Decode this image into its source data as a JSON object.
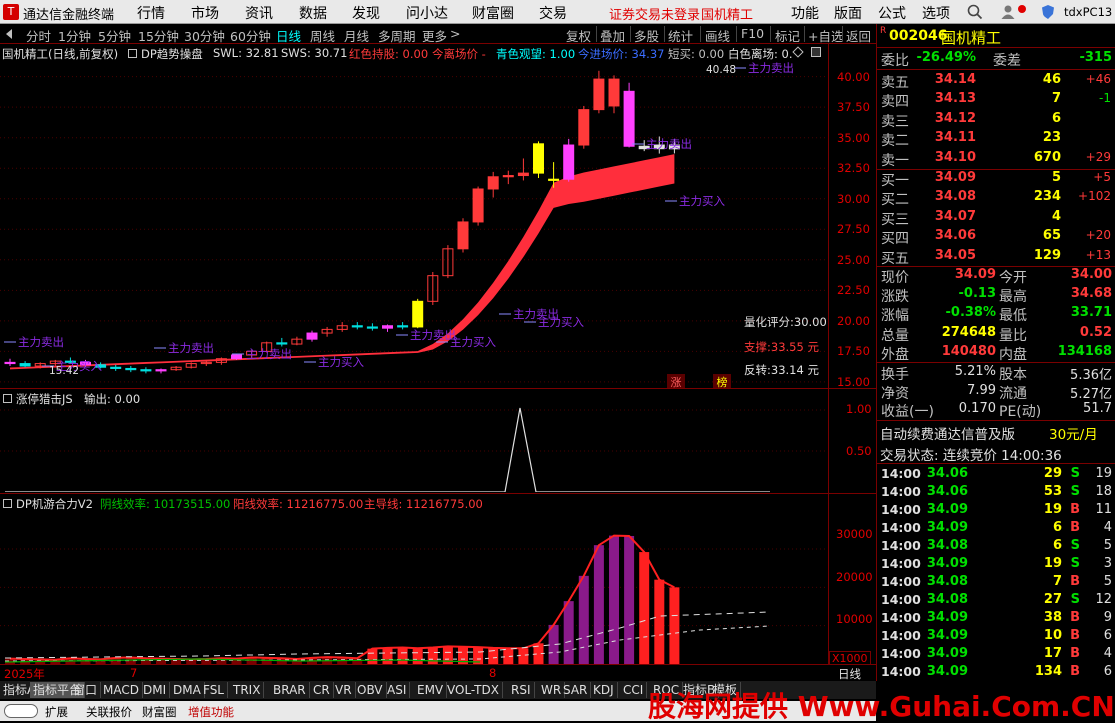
{
  "app": {
    "title": "通达信金融终端",
    "brand_color": "#d40000"
  },
  "menu": {
    "items": [
      "行情",
      "市场",
      "资讯",
      "数据",
      "发现",
      "问小达",
      "财富圈",
      "交易"
    ],
    "notice": "证券交易未登录",
    "stock": "国机精工",
    "right": [
      "功能",
      "版面",
      "公式",
      "选项"
    ],
    "user": "tdxPC13"
  },
  "period_tabs": [
    "分时",
    "1分钟",
    "5分钟",
    "15分钟",
    "30分钟",
    "60分钟",
    "日线",
    "周线",
    "月线",
    "多周期",
    "更多"
  ],
  "active_period": "日线",
  "toolbar_right": [
    "复权",
    "叠加",
    "多股",
    "统计",
    "画线",
    "F10",
    "标记",
    "+自选",
    "返回"
  ],
  "main_chart": {
    "title": "国机精工(日线,前复权)",
    "indicator": "DP趋势操盘",
    "swl": "SWL: 32.81",
    "sws": "SWS: 30.71",
    "legend": [
      {
        "text": "红色持股: 0.00",
        "color": "#ff3a3a"
      },
      {
        "text": "今离场价 -",
        "color": "#ff3a3a"
      },
      {
        "text": "青色观望: 1.00",
        "color": "#00ffff"
      },
      {
        "text": "今进场价: 34.37",
        "color": "#3a6cff"
      },
      {
        "text": "短买: 0.00",
        "color": "#c0c0c0"
      },
      {
        "text": "白色离场: 0.",
        "color": "#e0e0e0"
      }
    ],
    "y_ticks": [
      "40.00",
      "37.50",
      "35.00",
      "32.50",
      "30.00",
      "27.50",
      "25.00",
      "22.50",
      "20.00",
      "17.50",
      "15.00"
    ],
    "max_label": "40.48",
    "min_label": "15.42",
    "signals": {
      "sell": "主力卖出",
      "buy": "主力买入"
    },
    "score": "量化评分:30.00",
    "support": "支撑:33.55 元",
    "reversal": "反转:33.14 元",
    "markers": [
      "涨",
      "榜"
    ]
  },
  "panel2": {
    "title": "涨停猎击JS",
    "output": "输出: 0.00",
    "y_ticks": [
      "1.00",
      "0.50"
    ]
  },
  "panel3": {
    "title": "DP机游合力V2",
    "yin": "阴线效率: 10173515.00",
    "yang": "阳线效率: 11216775.00",
    "main": "主导线: 11216775.00",
    "y_ticks": [
      "30000",
      "20000",
      "10000"
    ],
    "unit": "X1000"
  },
  "axis": {
    "year": "2025年",
    "m7": "7",
    "m8": "8",
    "period": "日线"
  },
  "chart_data": {
    "type": "candlestick",
    "series": [
      {
        "name": "国机精工",
        "values": [
          [
            16.6,
            16.9,
            16.3,
            16.5
          ],
          [
            16.5,
            16.7,
            16.2,
            16.3
          ],
          [
            16.3,
            16.6,
            16.1,
            16.5
          ],
          [
            16.5,
            16.8,
            16.3,
            16.7
          ],
          [
            16.7,
            17,
            16.5,
            16.6
          ],
          [
            16.6,
            16.8,
            16.2,
            16.4
          ],
          [
            16.4,
            16.6,
            16.1,
            16.2
          ],
          [
            16.2,
            16.4,
            15.9,
            16.1
          ],
          [
            16.1,
            16.3,
            15.8,
            16
          ],
          [
            16,
            16.2,
            15.7,
            15.9
          ],
          [
            15.9,
            16.1,
            15.7,
            16
          ],
          [
            16,
            16.3,
            15.9,
            16.2
          ],
          [
            16.2,
            16.6,
            16.1,
            16.5
          ],
          [
            16.5,
            16.8,
            16.3,
            16.6
          ],
          [
            16.6,
            17,
            16.4,
            16.9
          ],
          [
            16.9,
            17.3,
            16.8,
            17.2
          ],
          [
            17.2,
            17.6,
            17,
            17.5
          ],
          [
            17.5,
            18.3,
            17.4,
            18.2
          ],
          [
            18.2,
            18.6,
            17.9,
            18.1
          ],
          [
            18.1,
            18.7,
            18,
            18.5
          ],
          [
            18.5,
            19.2,
            18.3,
            19
          ],
          [
            19,
            19.5,
            18.7,
            19.3
          ],
          [
            19.3,
            19.9,
            19.1,
            19.6
          ],
          [
            19.6,
            19.9,
            19.3,
            19.5
          ],
          [
            19.5,
            19.8,
            19.2,
            19.4
          ],
          [
            19.4,
            19.7,
            19.1,
            19.6
          ],
          [
            19.6,
            19.9,
            19.3,
            19.5
          ],
          [
            19.5,
            21.8,
            19.4,
            21.6
          ],
          [
            21.6,
            24,
            21.3,
            23.7
          ],
          [
            23.7,
            26.2,
            23.5,
            25.9
          ],
          [
            25.9,
            28.4,
            25.6,
            28.1
          ],
          [
            28.1,
            31,
            27.8,
            30.8
          ],
          [
            30.8,
            32.2,
            30.1,
            31.8
          ],
          [
            31.8,
            32.3,
            31.2,
            31.9
          ],
          [
            31.9,
            33.3,
            31.5,
            32.1
          ],
          [
            34.5,
            34.7,
            31.7,
            32.1
          ],
          [
            31.6,
            33,
            30.9,
            31.6
          ],
          [
            31.6,
            34.9,
            31.4,
            34.4
          ],
          [
            34.4,
            37.6,
            34.1,
            37.3
          ],
          [
            37.3,
            40.48,
            37,
            39.8
          ],
          [
            39.8,
            40.1,
            37,
            37.6
          ],
          [
            38.8,
            39.5,
            34.2,
            34.3
          ],
          [
            34.3,
            34.8,
            33.9,
            34.1
          ],
          [
            34.1,
            35.1,
            33.7,
            34.4
          ],
          [
            34.4,
            34.9,
            33.71,
            34.09
          ]
        ]
      }
    ],
    "ylim": [
      15,
      40.48
    ]
  },
  "quote": {
    "code": "002046",
    "name": "国机精工",
    "weibi": "-26.49%",
    "weicha": "-315",
    "asks": [
      {
        "l": "卖五",
        "p": "34.14",
        "v": "46",
        "c": "+46"
      },
      {
        "l": "卖四",
        "p": "34.13",
        "v": "7",
        "c": "-1"
      },
      {
        "l": "卖三",
        "p": "34.12",
        "v": "6",
        "c": ""
      },
      {
        "l": "卖二",
        "p": "34.11",
        "v": "23",
        "c": ""
      },
      {
        "l": "卖一",
        "p": "34.10",
        "v": "670",
        "c": "+29"
      }
    ],
    "bids": [
      {
        "l": "买一",
        "p": "34.09",
        "v": "5",
        "c": "+5"
      },
      {
        "l": "买二",
        "p": "34.08",
        "v": "234",
        "c": "+102"
      },
      {
        "l": "买三",
        "p": "34.07",
        "v": "4",
        "c": ""
      },
      {
        "l": "买四",
        "p": "34.06",
        "v": "65",
        "c": "+20"
      },
      {
        "l": "买五",
        "p": "34.05",
        "v": "129",
        "c": "+13"
      }
    ],
    "stats": [
      [
        "现价",
        "34.09",
        "今开",
        "34.00"
      ],
      [
        "涨跌",
        "-0.13",
        "最高",
        "34.68"
      ],
      [
        "涨幅",
        "-0.38%",
        "最低",
        "33.71"
      ],
      [
        "总量",
        "274648",
        "量比",
        "0.52"
      ],
      [
        "外盘",
        "140480",
        "内盘",
        "134168"
      ]
    ],
    "stats2": [
      [
        "换手",
        "5.21%",
        "股本",
        "5.36亿"
      ],
      [
        "净资",
        "7.99",
        "流通",
        "5.27亿"
      ],
      [
        "收益(一)",
        "0.170",
        "PE(动)",
        "51.7"
      ]
    ],
    "ad": "自动续费通达信普及版",
    "price_tag": "30元/月",
    "status": "交易状态: 连续竞价 14:00:36",
    "ticks": [
      [
        "14:00",
        "34.06",
        "29",
        "S",
        "19"
      ],
      [
        "14:00",
        "34.06",
        "53",
        "S",
        "18"
      ],
      [
        "14:00",
        "34.09",
        "19",
        "B",
        "11"
      ],
      [
        "14:00",
        "34.09",
        "6",
        "B",
        "4"
      ],
      [
        "14:00",
        "34.08",
        "6",
        "S",
        "5"
      ],
      [
        "14:00",
        "34.09",
        "19",
        "S",
        "3"
      ],
      [
        "14:00",
        "34.08",
        "7",
        "B",
        "5"
      ],
      [
        "14:00",
        "34.08",
        "27",
        "S",
        "12"
      ],
      [
        "14:00",
        "34.09",
        "38",
        "B",
        "9"
      ],
      [
        "14:00",
        "34.09",
        "10",
        "B",
        "6"
      ],
      [
        "14:00",
        "34.09",
        "17",
        "B",
        "4"
      ],
      [
        "14:00",
        "34.09",
        "134",
        "B",
        "6"
      ]
    ]
  },
  "bottom_tabs": [
    "指标A",
    "指标平台",
    "窗口",
    "MACD",
    "DMI",
    "DMA",
    "FSL",
    "TRIX",
    "BRAR",
    "CR",
    "VR",
    "OBV",
    "ASI",
    "EMV",
    "VOL-TDX",
    "RSI",
    "WR",
    "SAR",
    "KDJ",
    "CCI",
    "ROC",
    "指标B",
    "模板"
  ],
  "bottom_tabs2": [
    "扩展",
    "关联报价",
    "财富圈",
    "增值功能"
  ],
  "watermark": "股海网提供 Www.Guhai.Com.CN"
}
